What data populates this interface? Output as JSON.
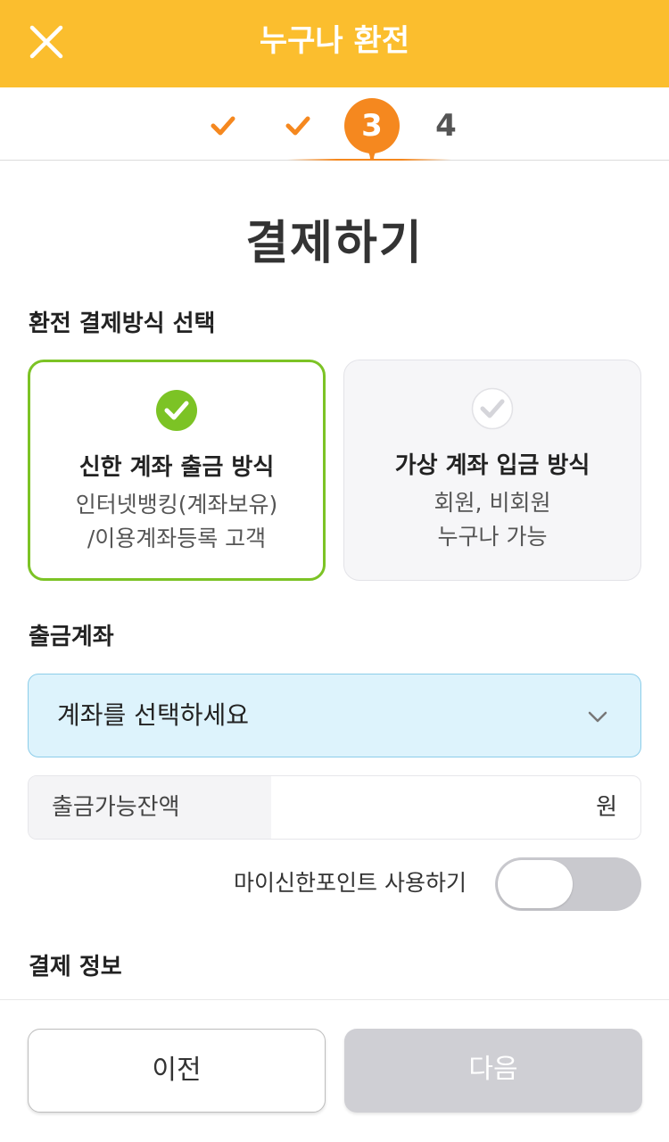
{
  "header": {
    "title": "누구나 환전",
    "close_icon": "close-icon",
    "background_color": "#fbbe2e"
  },
  "stepper": {
    "steps": [
      {
        "label": "",
        "state": "done",
        "icon": "check-icon"
      },
      {
        "label": "",
        "state": "done",
        "icon": "check-icon"
      },
      {
        "label": "3",
        "state": "current"
      },
      {
        "label": "4",
        "state": "pending"
      }
    ],
    "accent_color": "#f5881f"
  },
  "page": {
    "title": "결제하기"
  },
  "payment_method": {
    "section_label": "환전 결제방식 선택",
    "options": [
      {
        "title": "신한 계좌 출금 방식",
        "desc_line1": "인터넷뱅킹(계좌보유)",
        "desc_line2": "/이용계좌등록 고객",
        "selected": true,
        "icon": "check-circle-icon"
      },
      {
        "title": "가상 계좌 입금 방식",
        "desc_line1": "회원, 비회원",
        "desc_line2": "누구나 가능",
        "selected": false,
        "icon": "check-circle-icon"
      }
    ],
    "selected_color": "#7cc325"
  },
  "withdrawal_account": {
    "section_label": "출금계좌",
    "select_placeholder": "계좌를 선택하세요",
    "chevron_icon": "chevron-down-icon",
    "balance_label": "출금가능잔액",
    "balance_value": "",
    "balance_unit": "원"
  },
  "points": {
    "label": "마이신한포인트 사용하기",
    "enabled": false
  },
  "payment_info": {
    "section_label": "결제 정보"
  },
  "footer": {
    "prev_label": "이전",
    "next_label": "다음",
    "next_enabled": false
  }
}
